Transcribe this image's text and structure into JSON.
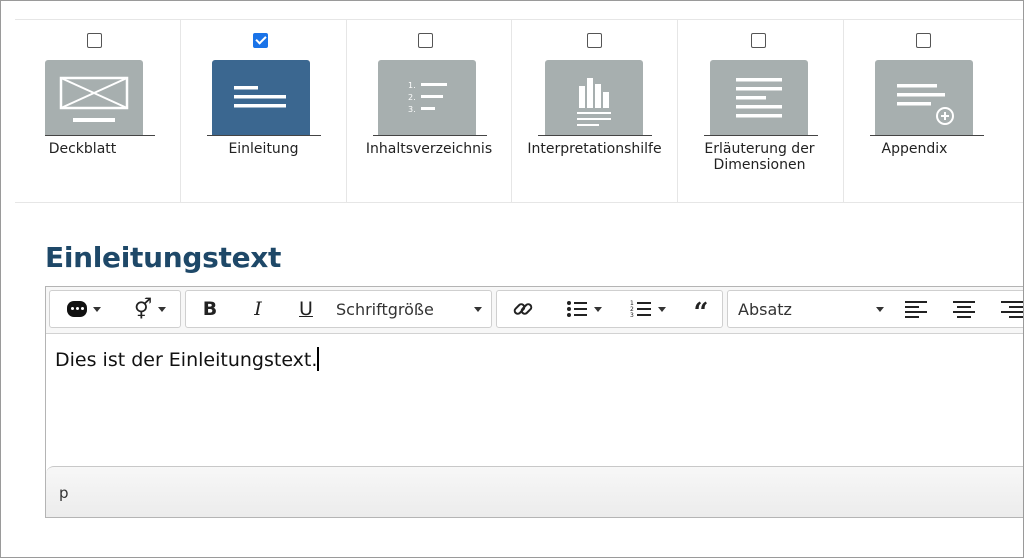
{
  "sections": [
    {
      "id": "deckblatt",
      "label": "Deckblatt",
      "checked": false,
      "icon": "cover-page-icon"
    },
    {
      "id": "einleitung",
      "label": "Einleitung",
      "checked": true,
      "icon": "intro-text-icon"
    },
    {
      "id": "inhaltsverzeichnis",
      "label": "Inhaltsverzeichnis",
      "checked": false,
      "icon": "table-of-contents-icon"
    },
    {
      "id": "interpretationshilfe",
      "label": "Interpretationshilfe",
      "checked": false,
      "icon": "bar-chart-icon"
    },
    {
      "id": "erlaeuterung",
      "label": "Erläuterung der Dimensionen",
      "checked": false,
      "icon": "dimensions-text-icon"
    },
    {
      "id": "appendix",
      "label": "Appendix",
      "checked": false,
      "icon": "appendix-add-icon"
    }
  ],
  "heading": "Einleitungstext",
  "toolbar": {
    "font_size_label": "Schriftgröße",
    "paragraph_label": "Absatz"
  },
  "editor": {
    "content": "Dies ist der Einleitungstext.",
    "status_path": "p"
  },
  "colors": {
    "heading": "#1e4868",
    "active_thumb": "#3b6790",
    "inactive_thumb": "#a7afaf",
    "checkbox_checked": "#1a73e8"
  }
}
